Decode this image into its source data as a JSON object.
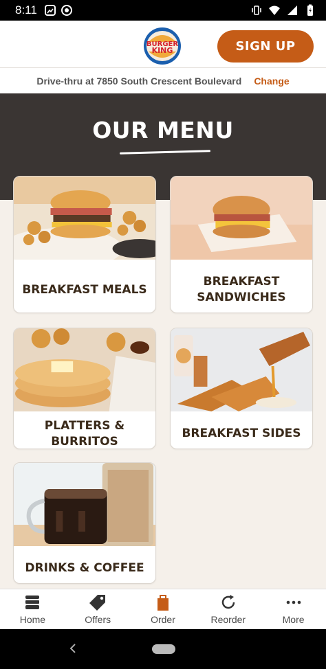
{
  "status_bar": {
    "time": "8:11"
  },
  "header": {
    "logo_text_top": "BURGER",
    "logo_text_bottom": "KING",
    "signup_label": "SIGN UP"
  },
  "location": {
    "text": "Drive-thru at 7850 South Crescent Boulevard",
    "change_label": "Change"
  },
  "hero": {
    "title": "OUR MENU"
  },
  "menu": {
    "items": [
      {
        "label": "BREAKFAST MEALS"
      },
      {
        "label": "BREAKFAST SANDWICHES"
      },
      {
        "label": "PLATTERS & BURRITOS"
      },
      {
        "label": "BREAKFAST SIDES"
      },
      {
        "label": "DRINKS & COFFEE"
      }
    ]
  },
  "bottom_nav": {
    "items": [
      {
        "label": "Home",
        "icon": "home-stack-icon"
      },
      {
        "label": "Offers",
        "icon": "tag-icon"
      },
      {
        "label": "Order",
        "icon": "bag-icon"
      },
      {
        "label": "Reorder",
        "icon": "refresh-icon"
      },
      {
        "label": "More",
        "icon": "more-dots-icon"
      }
    ],
    "active": "Order"
  },
  "colors": {
    "brand_orange": "#c55c17",
    "hero_bg": "#3a3533",
    "page_bg": "#f5f0ea"
  }
}
